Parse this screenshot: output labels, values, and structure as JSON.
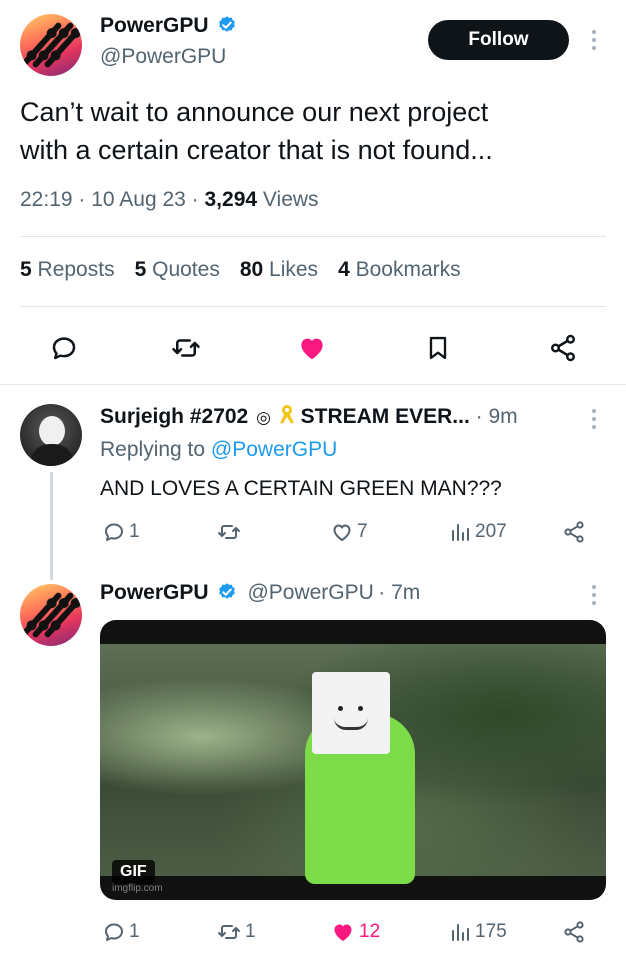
{
  "main_tweet": {
    "name": "PowerGPU",
    "handle": "@PowerGPU",
    "follow_label": "Follow",
    "text_line1": "Can’t wait to announce our next project",
    "text_line2": "with a certain creator that is not found...",
    "time": "22:19",
    "date": "10 Aug 23",
    "views_count": "3,294",
    "views_label": "Views",
    "reposts_count": "5",
    "reposts_label": "Reposts",
    "quotes_count": "5",
    "quotes_label": "Quotes",
    "likes_count": "80",
    "likes_label": "Likes",
    "bookmarks_count": "4",
    "bookmarks_label": "Bookmarks"
  },
  "reply1": {
    "name": "Surjeigh #2702",
    "name_suffix": "STREAM EVER...",
    "time": "9m",
    "replying_prefix": "Replying to",
    "replying_handle": "@PowerGPU",
    "text": "AND LOVES A CERTAIN GREEN MAN???",
    "replies": "1",
    "reposts": "",
    "likes": "7",
    "views": "207"
  },
  "reply2": {
    "name": "PowerGPU",
    "handle": "@PowerGPU",
    "time": "7m",
    "gif_badge": "GIF",
    "gif_watermark": "imgflip.com",
    "replies": "1",
    "reposts": "1",
    "likes": "12",
    "views": "175"
  },
  "colors": {
    "accent": "#1d9bf0",
    "like": "#f91880",
    "secondary_text": "#536471"
  }
}
